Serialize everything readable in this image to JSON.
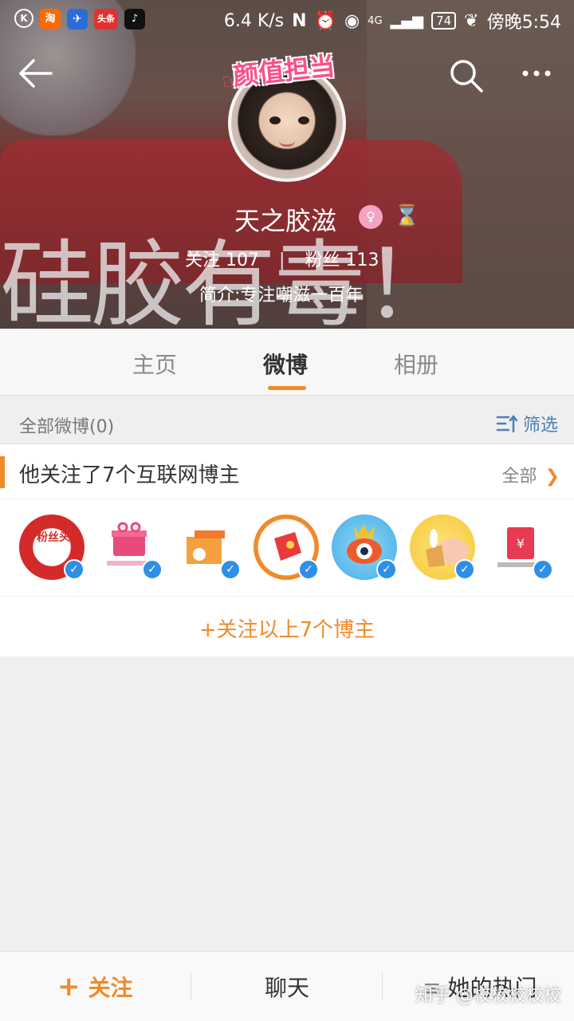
{
  "status_bar": {
    "apps": [
      "K",
      "淘",
      "✈",
      "头条",
      "♪"
    ],
    "speed": "6.4 K/s",
    "network": "4G",
    "battery": "74",
    "time": "傍晚5:54"
  },
  "cover": {
    "overlay_text": "硅胶有毒！",
    "badge_text": "颜值担当"
  },
  "profile": {
    "name": "天之胶滋",
    "following_label": "关注",
    "following_count": "107",
    "followers_label": "粉丝",
    "followers_count": "113",
    "bio": "简介:专注嘲滋一百年"
  },
  "tabs": [
    {
      "label": "主页"
    },
    {
      "label": "微博"
    },
    {
      "label": "相册"
    }
  ],
  "feed": {
    "count_label": "全部微博(0)",
    "filter_label": "筛选"
  },
  "followed_card": {
    "title": "他关注了7个互联网博主",
    "all_label": "全部",
    "follow_all_label": "+关注以上7个博主",
    "accounts": [
      {
        "name": "粉丝头条",
        "badge": "✓"
      },
      {
        "name": "微博会员",
        "badge": "✓"
      },
      {
        "name": "card",
        "badge": "✓"
      },
      {
        "name": "红包",
        "badge": "✓"
      },
      {
        "name": "fish",
        "badge": "✓"
      },
      {
        "name": "bunny",
        "badge": "✓"
      },
      {
        "name": "微博红包",
        "badge": "✓"
      }
    ]
  },
  "bottom_bar": {
    "follow_label": "关注",
    "chat_label": "聊天",
    "hot_label": "她的热门"
  },
  "watermark": "知乎 @校校校校校",
  "colors": {
    "accent": "#f08a2a",
    "link_blue": "#4c7fb8",
    "verify_blue": "#2f8fe8"
  }
}
